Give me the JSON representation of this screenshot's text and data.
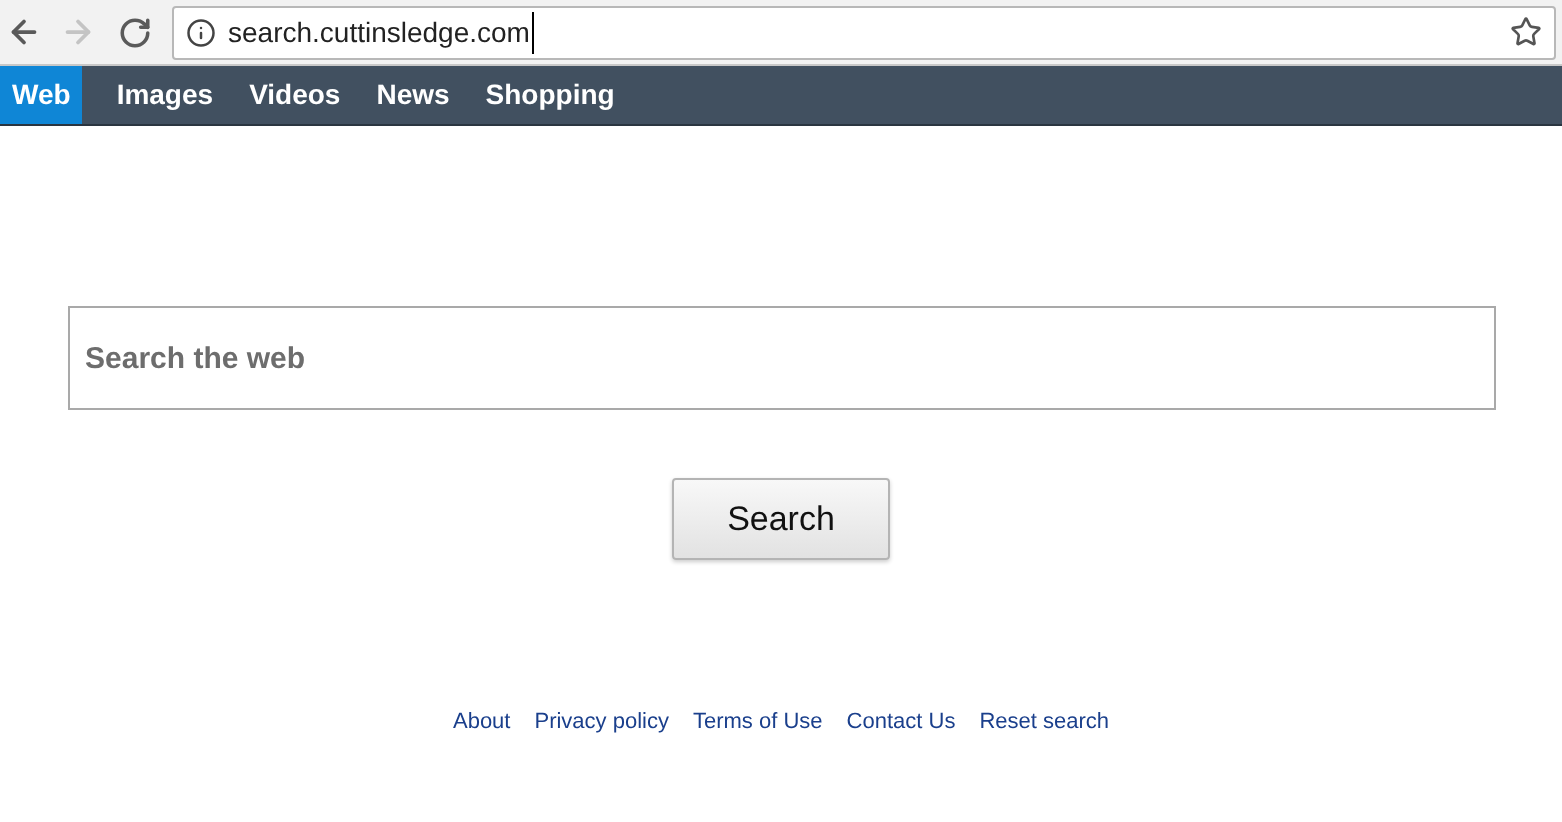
{
  "browser": {
    "url": "search.cuttinsledge.com",
    "back_disabled": false,
    "forward_disabled": true
  },
  "tabs": [
    {
      "label": "Web",
      "selected": true
    },
    {
      "label": "Images",
      "selected": false
    },
    {
      "label": "Videos",
      "selected": false
    },
    {
      "label": "News",
      "selected": false
    },
    {
      "label": "Shopping",
      "selected": false
    }
  ],
  "search": {
    "placeholder": "Search the web",
    "button": "Search"
  },
  "footer_links": [
    "About",
    "Privacy policy",
    "Terms of Use",
    "Contact Us",
    "Reset search"
  ]
}
